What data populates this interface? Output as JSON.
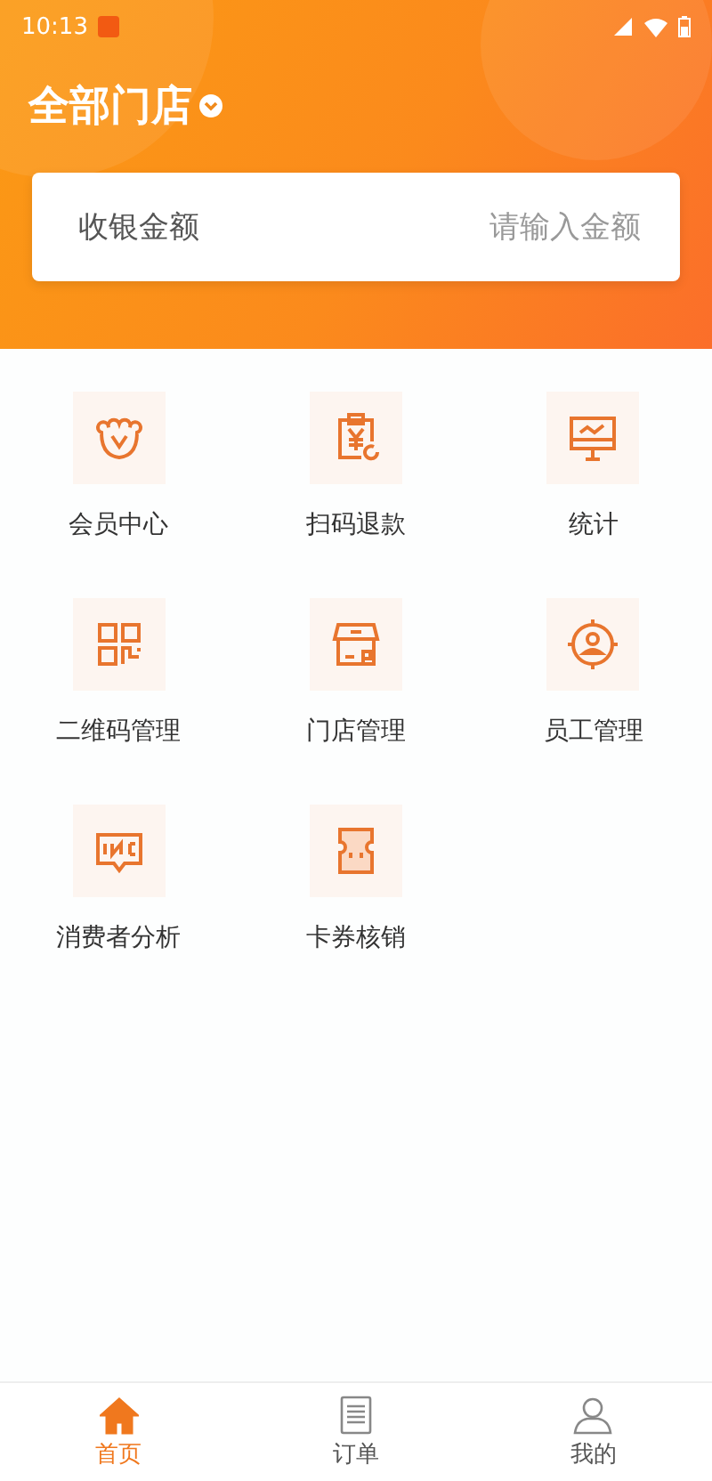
{
  "status_bar": {
    "time": "10:13"
  },
  "header": {
    "store": "全部门店"
  },
  "cashier": {
    "label": "收银金额",
    "placeholder": "请输入金额"
  },
  "menu": [
    {
      "label": "会员中心"
    },
    {
      "label": "扫码退款"
    },
    {
      "label": "统计"
    },
    {
      "label": "二维码管理"
    },
    {
      "label": "门店管理"
    },
    {
      "label": "员工管理"
    },
    {
      "label": "消费者分析"
    },
    {
      "label": "卡券核销"
    }
  ],
  "tabs": [
    {
      "label": "首页",
      "selected": true
    },
    {
      "label": "订单",
      "selected": false
    },
    {
      "label": "我的",
      "selected": false
    }
  ]
}
